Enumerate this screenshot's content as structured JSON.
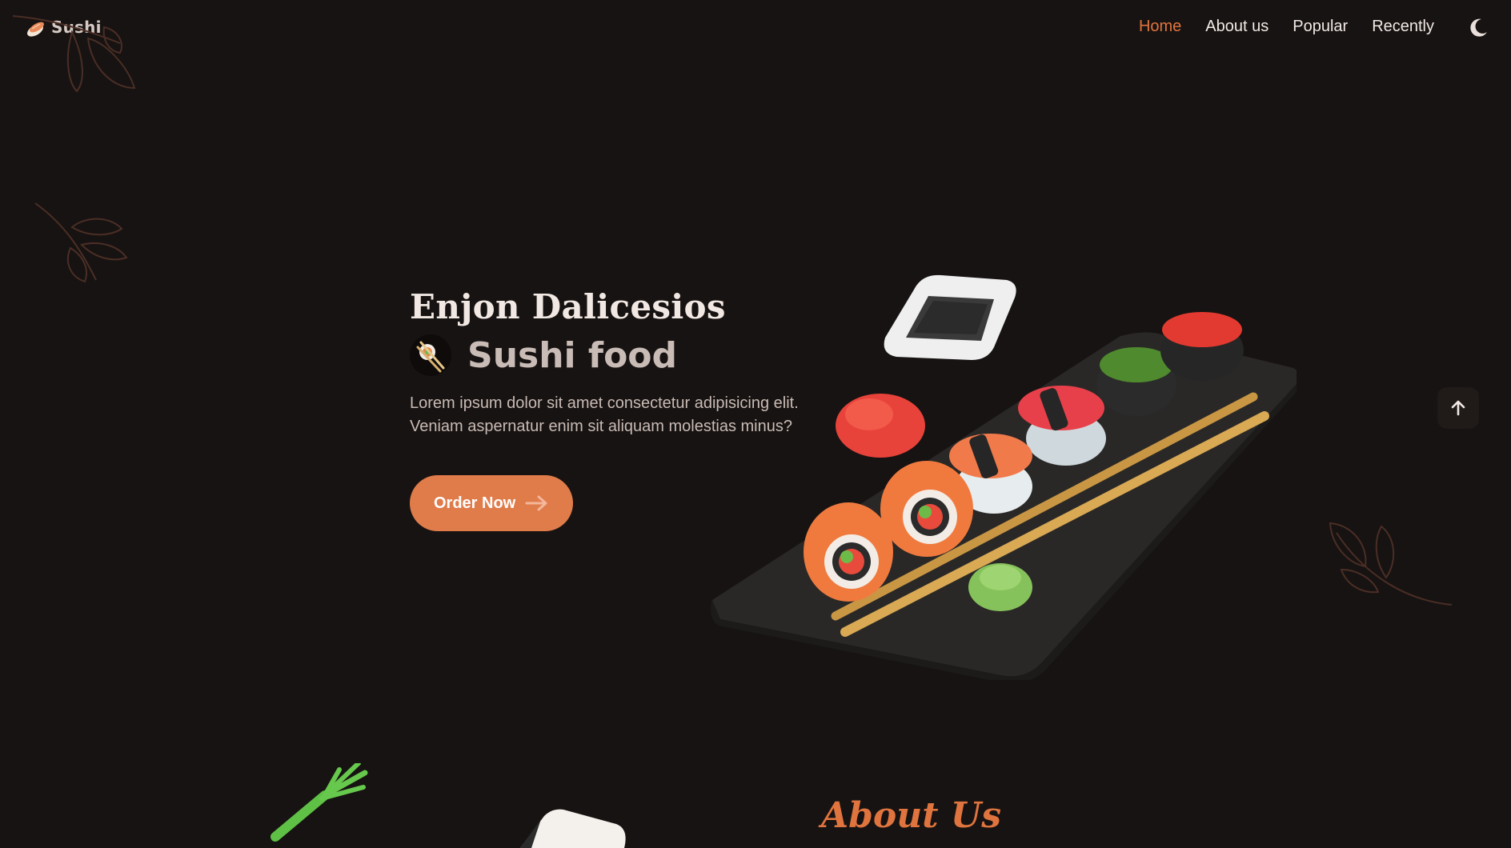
{
  "header": {
    "logo_text": "Sushi",
    "logo_icon": "sushi-roll-icon",
    "nav": [
      {
        "label": "Home",
        "active": true
      },
      {
        "label": "About us",
        "active": false
      },
      {
        "label": "Popular",
        "active": false
      },
      {
        "label": "Recently",
        "active": false
      }
    ],
    "theme_toggle_icon": "moon-icon"
  },
  "hero": {
    "title": "Enjon Dalicesios",
    "subtitle": "Sushi food",
    "subtitle_icon": "chopsticks-sushi-icon",
    "description": "Lorem ipsum dolor sit amet consectetur adipisicing elit. Veniam aspernatur enim sit aliquam molestias minus?",
    "button_label": "Order Now",
    "button_icon": "arrow-right-icon",
    "image_alt": "sushi-plate-image"
  },
  "scroll_up_icon": "arrow-up-icon",
  "about": {
    "title": "About Us"
  },
  "colors": {
    "background": "#171312",
    "accent": "#e0743e",
    "button": "#e07b4a",
    "text": "#f1e9e5"
  }
}
